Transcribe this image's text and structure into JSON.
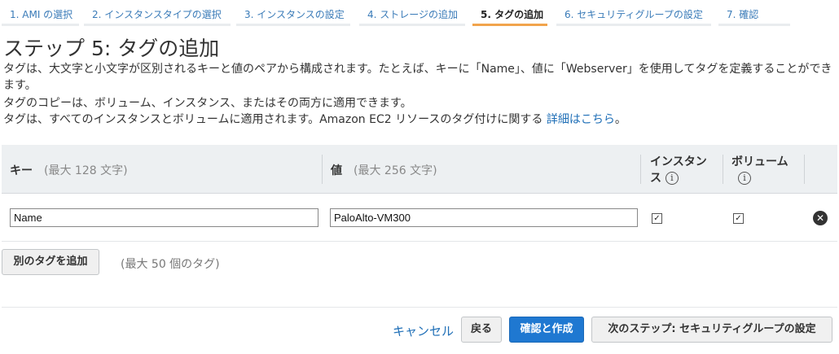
{
  "wizard": {
    "steps": [
      {
        "label": "1. AMI の選択"
      },
      {
        "label": "2. インスタンスタイプの選択"
      },
      {
        "label": "3. インスタンスの設定"
      },
      {
        "label": "4. ストレージの追加"
      },
      {
        "label": "5. タグの追加"
      },
      {
        "label": "6. セキュリティグループの設定"
      },
      {
        "label": "7. 確認"
      }
    ],
    "active_step": 5
  },
  "page": {
    "title": "ステップ 5: タグの追加",
    "desc_line1": "タグは、大文字と小文字が区別されるキーと値のペアから構成されます。たとえば、キーに「Name」、値に「Webserver」を使用してタグを定義することができ",
    "desc_line2": "ます。",
    "desc_line3": "タグのコピーは、ボリューム、インスタンス、またはその両方に適用できます。",
    "desc_line4": "タグは、すべてのインスタンスとボリュームに適用されます。Amazon EC2 リソースのタグ付けに関する",
    "learn_more_link": "詳細はこちら",
    "desc_line4_end": "。"
  },
  "table": {
    "key_header": "キー",
    "key_hint": "(最大 128 文字)",
    "value_header": "値",
    "value_hint": "(最大 256 文字)",
    "instances_header_1": "インスタン",
    "instances_header_2": "ス",
    "volumes_header": "ボリューム",
    "info_icon": "i",
    "rows": [
      {
        "key": "Name",
        "value": "PaloAlto-VM300",
        "instances": true,
        "volumes": true
      }
    ]
  },
  "actions": {
    "add_tag": "別のタグを追加",
    "tag_limit_hint": "(最大 50 個のタグ)",
    "cancel": "キャンセル",
    "back": "戻る",
    "review_launch": "確認と作成",
    "next_step": "次のステップ: セキュリティグループの設定"
  },
  "colors": {
    "link": "#1f6fb7",
    "primary_button": "#1f78d1",
    "active_step_underline": "#f1a44c",
    "table_header_bg": "#edf0f2"
  }
}
